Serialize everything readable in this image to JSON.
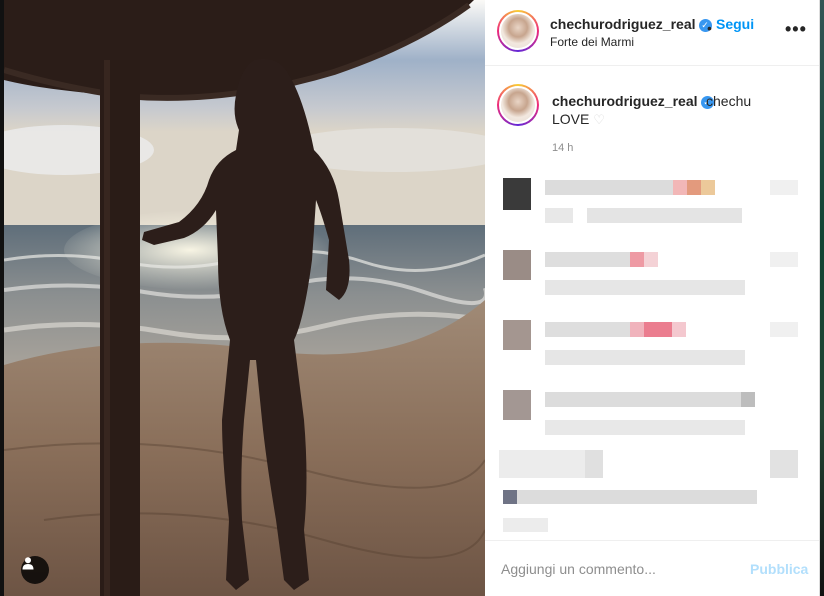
{
  "post": {
    "username": "chechurodriguez_real",
    "follow_label": "Segui",
    "separator": "•",
    "location": "Forte dei Marmi",
    "more_label": "•••"
  },
  "caption": {
    "username": "chechurodriguez_real",
    "text_line1": "chechu",
    "text_line2": "LOVE",
    "heart": "♡",
    "timestamp": "14 h"
  },
  "comment_box": {
    "placeholder": "Aggiungi un commento...",
    "publish_label": "Pubblica"
  },
  "icons": {
    "verified": "✓",
    "user_tag": "user-icon"
  },
  "colors": {
    "accent": "#0095f6",
    "verified": "#3897f0",
    "publish_disabled": "#b2dffc",
    "secondary_text": "#8e8e8e"
  }
}
